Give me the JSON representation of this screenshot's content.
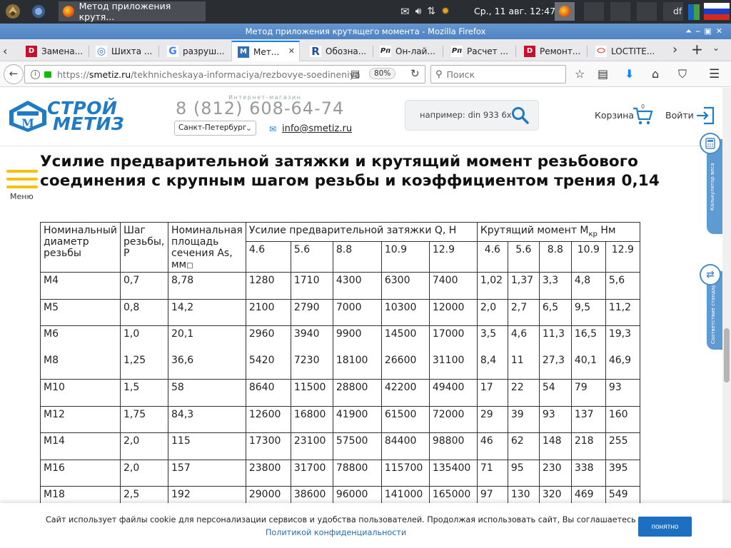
{
  "os_panel": {
    "task_title": "Метод приложения крутя...",
    "clock": "Ср., 11 авг.  12:47",
    "user": "df"
  },
  "browser": {
    "window_title": "Метод приложения крутящего момента - Mozilla Firefox",
    "tabs": [
      {
        "label": "Замена...",
        "fav": "D",
        "color": "#c8102e"
      },
      {
        "label": "Шихта ...",
        "fav": "◎",
        "color": "#2b7bd6"
      },
      {
        "label": "разруш...",
        "fav": "G",
        "color": "#4285f4"
      },
      {
        "label": "Мет...",
        "fav": "M",
        "color": "#2f6fb8"
      },
      {
        "label": "Обозна...",
        "fav": "R",
        "color": "#1f4e9e"
      },
      {
        "label": "Он-лай...",
        "fav": "Рп",
        "color": "#222222"
      },
      {
        "label": "Расчет ...",
        "fav": "Рп",
        "color": "#222222"
      },
      {
        "label": "Ремонт...",
        "fav": "D",
        "color": "#c8102e"
      },
      {
        "label": "LOCTITE...",
        "fav": "⬭",
        "color": "#e03c31"
      }
    ],
    "url_prefix": "https://",
    "url_domain": "smetiz.ru",
    "url_path": "/tekhnicheskaya-informaciya/rezbovye-soedineniya",
    "zoom": "80%",
    "search_placeholder": "Поиск"
  },
  "site": {
    "phone_sub": "Интернет-магазин",
    "phone": "8 (812) 608-64-74",
    "city": "Санкт-Петербург",
    "email": "info@smetiz.ru",
    "search_placeholder": "например: din 933 6x",
    "cart_label": "Корзина",
    "cart_count": "0",
    "login_label": "Войти",
    "menu_label": "Меню",
    "side_tab_1": "Калькулятор веса",
    "side_tab_2": "Соответствие стандартов",
    "logo_line1": "СТРОЙ",
    "logo_line2": "МЕТИЗ"
  },
  "article": {
    "title": "Усилие предварительной затяжки и крутящий момент резьбового соединения с крупным шагом резьбы и коэффициентом трения 0,14"
  },
  "table": {
    "headers": {
      "diameter": "Номинальный диаметр резьбы",
      "pitch": "Шаг резьбы, P",
      "area": "Номинальная площадь сечения As, мм",
      "area_glyph": "□",
      "preload": "Усилие предварительной затяжки Q, Н",
      "torque_prefix": "Крутящий момент M",
      "torque_sub": "кр",
      "torque_unit": " Нм"
    },
    "classes": [
      "4.6",
      "5.6",
      "8.8",
      "10.9",
      "12.9"
    ],
    "rows": [
      {
        "d": "M4",
        "p": "0,7",
        "a": "8,78",
        "q": [
          "1280",
          "1710",
          "4300",
          "6300",
          "7400"
        ],
        "m": [
          "1,02",
          "1,37",
          "3,3",
          "4,8",
          "5,6"
        ]
      },
      {
        "d": "M5",
        "p": "0,8",
        "a": "14,2",
        "q": [
          "2100",
          "2790",
          "7000",
          "10300",
          "12000"
        ],
        "m": [
          "2,0",
          "2,7",
          "6,5",
          "9,5",
          "11,2"
        ]
      },
      {
        "d": "M6",
        "p": "1,0",
        "a": "20,1",
        "q": [
          "2960",
          "3940",
          "9900",
          "14500",
          "17000"
        ],
        "m": [
          "3,5",
          "4,6",
          "11,3",
          "16,5",
          "19,3"
        ],
        "d2": "M8",
        "p2": "1,25",
        "a2": "36,6",
        "q2": [
          "5420",
          "7230",
          "18100",
          "26600",
          "31100"
        ],
        "m2": [
          "8,4",
          "11",
          "27,3",
          "40,1",
          "46,9"
        ]
      },
      {
        "d": "M10",
        "p": "1,5",
        "a": "58",
        "q": [
          "8640",
          "11500",
          "28800",
          "42200",
          "49400"
        ],
        "m": [
          "17",
          "22",
          "54",
          "79",
          "93"
        ]
      },
      {
        "d": "M12",
        "p": "1,75",
        "a": "84,3",
        "q": [
          "12600",
          "16800",
          "41900",
          "61500",
          "72000"
        ],
        "m": [
          "29",
          "39",
          "93",
          "137",
          "160"
        ]
      },
      {
        "d": "M14",
        "p": "2,0",
        "a": "115",
        "q": [
          "17300",
          "23100",
          "57500",
          "84400",
          "98800"
        ],
        "m": [
          "46",
          "62",
          "148",
          "218",
          "255"
        ]
      },
      {
        "d": "M16",
        "p": "2,0",
        "a": "157",
        "q": [
          "23800",
          "31700",
          "78800",
          "115700",
          "135400"
        ],
        "m": [
          "71",
          "95",
          "230",
          "338",
          "395"
        ]
      },
      {
        "d": "M18",
        "p": "2,5",
        "a": "192",
        "q": [
          "29000",
          "38600",
          "96000",
          "141000",
          "165000"
        ],
        "m": [
          "97",
          "130",
          "320",
          "469",
          "549"
        ]
      }
    ]
  },
  "cookie": {
    "text": "Сайт использует файлы cookie для персонализации сервисов и удобства пользователей. Продолжая использовать сайт, Вы соглашаетесь с",
    "link": "Политикой конфиденциальности",
    "button": "понятно"
  }
}
